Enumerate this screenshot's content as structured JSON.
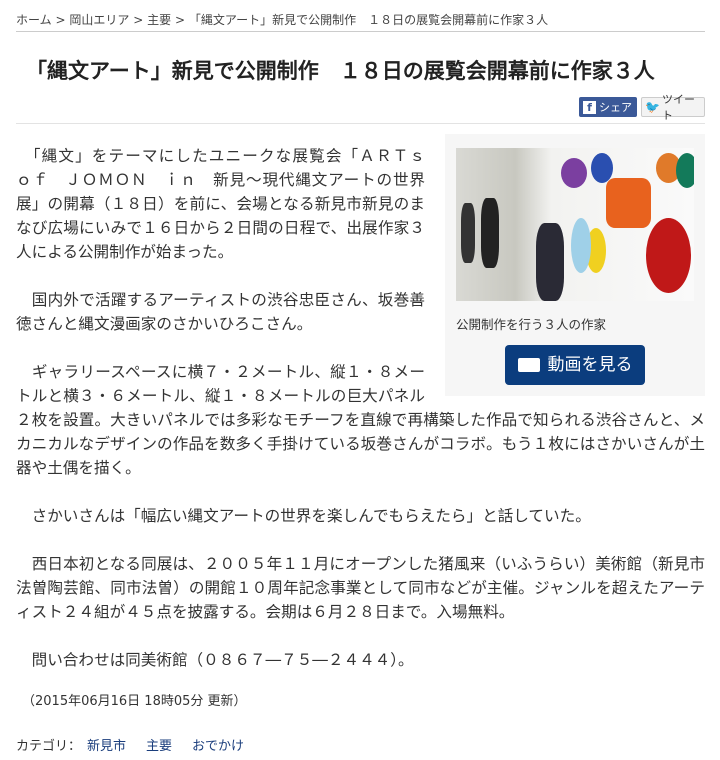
{
  "breadcrumb": [
    {
      "label": "ホーム"
    },
    {
      "label": "岡山エリア"
    },
    {
      "label": "主要"
    },
    {
      "label": "「縄文アート」新見で公開制作　１８日の展覧会開幕前に作家３人"
    }
  ],
  "breadcrumb_sep": ">",
  "title": "「縄文アート」新見で公開制作　１８日の展覧会開幕前に作家３人",
  "share": {
    "facebook": "シェア",
    "twitter": "ツイート"
  },
  "figure": {
    "caption": "公開制作を行う３人の作家",
    "video_button": "動画を見る",
    "video_color": "#0b3d7e"
  },
  "paragraphs": [
    "　「縄文」をテーマにしたユニークな展覧会「ＡＲＴｓ　ｏｆ　ＪＯＭＯＮ　ｉｎ　新見～現代縄文アートの世界展」の開幕（１８日）を前に、会場となる新見市新見のまなび広場にいみで１６日から２日間の日程で、出展作家３人による公開制作が始まった。",
    "　国内外で活躍するアーティストの渋谷忠臣さん、坂巻善徳さんと縄文漫画家のさかいひろこさん。",
    "　ギャラリースペースに横７・２メートル、縦１・８メートルと横３・６メートル、縦１・８メートルの巨大パネル２枚を設置。大きいパネルでは多彩なモチーフを直線で再構築した作品で知られる渋谷さんと、メカニカルなデザインの作品を数多く手掛けている坂巻さんがコラボ。もう１枚にはさかいさんが土器や土偶を描く。",
    "　さかいさんは「幅広い縄文アートの世界を楽しんでもらえたら」と話していた。",
    "　西日本初となる同展は、２００５年１１月にオープンした猪風来（いふうらい）美術館（新見市法曽陶芸館、同市法曽）の開館１０周年記念事業として同市などが主催。ジャンルを超えたアーティスト２４組が４５点を披露する。会期は６月２８日まで。入場無料。",
    "　問い合わせは同美術館（０８６７―７５―２４４４）。"
  ],
  "updated": "（2015年06月16日 18時05分 更新）",
  "category": {
    "label": "カテゴリ：",
    "items": [
      "新見市",
      "主要",
      "おでかけ"
    ]
  }
}
